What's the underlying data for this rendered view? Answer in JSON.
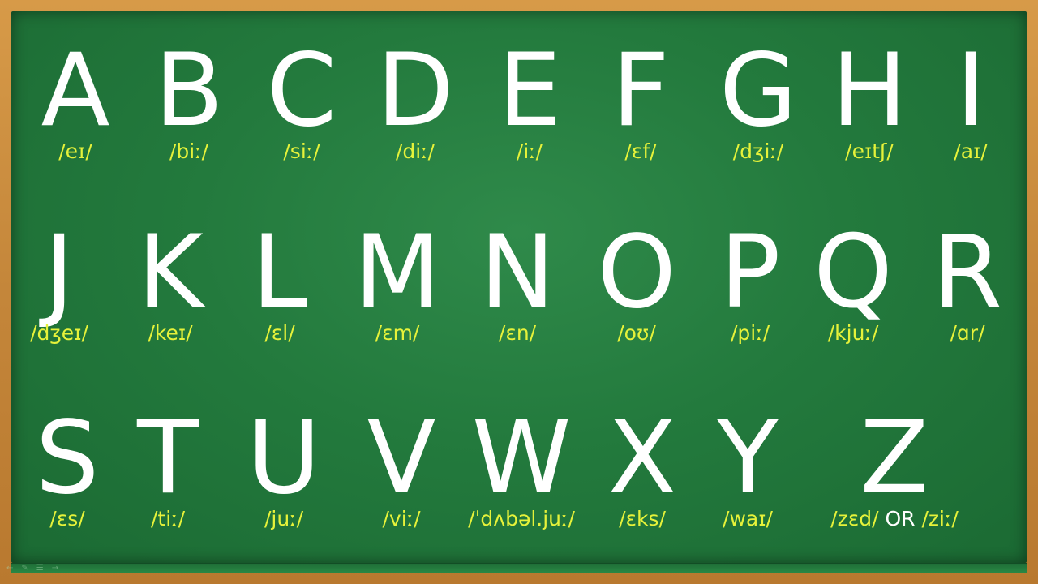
{
  "board": {
    "rows": [
      [
        {
          "letter": "A",
          "ipa": "/eɪ/"
        },
        {
          "letter": "B",
          "ipa": "/biː/"
        },
        {
          "letter": "C",
          "ipa": "/siː/"
        },
        {
          "letter": "D",
          "ipa": "/diː/"
        },
        {
          "letter": "E",
          "ipa": "/iː/"
        },
        {
          "letter": "F",
          "ipa": "/ɛf/"
        },
        {
          "letter": "G",
          "ipa": "/dʒiː/"
        },
        {
          "letter": "H",
          "ipa": "/eɪtʃ/"
        },
        {
          "letter": "I",
          "ipa": "/aɪ/"
        }
      ],
      [
        {
          "letter": "J",
          "ipa": "/dʒeɪ/"
        },
        {
          "letter": "K",
          "ipa": "/keɪ/"
        },
        {
          "letter": "L",
          "ipa": "/ɛl/"
        },
        {
          "letter": "M",
          "ipa": "/ɛm/"
        },
        {
          "letter": "N",
          "ipa": "/ɛn/"
        },
        {
          "letter": "O",
          "ipa": "/oʊ/"
        },
        {
          "letter": "P",
          "ipa": "/piː/"
        },
        {
          "letter": "Q",
          "ipa": "/kjuː/"
        },
        {
          "letter": "R",
          "ipa": "/ɑr/"
        }
      ],
      [
        {
          "letter": "S",
          "ipa": "/ɛs/"
        },
        {
          "letter": "T",
          "ipa": "/tiː/"
        },
        {
          "letter": "U",
          "ipa": "/juː/"
        },
        {
          "letter": "V",
          "ipa": "/viː/"
        },
        {
          "letter": "W",
          "ipa": "/ˈdʌbəl.juː/"
        },
        {
          "letter": "X",
          "ipa": "/ɛks/"
        },
        {
          "letter": "Y",
          "ipa": "/waɪ/"
        },
        {
          "letter": "Z",
          "ipa": "/zɛd/",
          "or_label": "OR",
          "ipa_alt": "/ziː/"
        }
      ]
    ]
  },
  "colors": {
    "board": "#237a3d",
    "frame": "#c58a3c",
    "letter": "#ffffff",
    "ipa": "#e6f23a"
  },
  "icons": [
    "arrow-left-icon",
    "pencil-icon",
    "menu-icon",
    "arrow-right-icon"
  ]
}
